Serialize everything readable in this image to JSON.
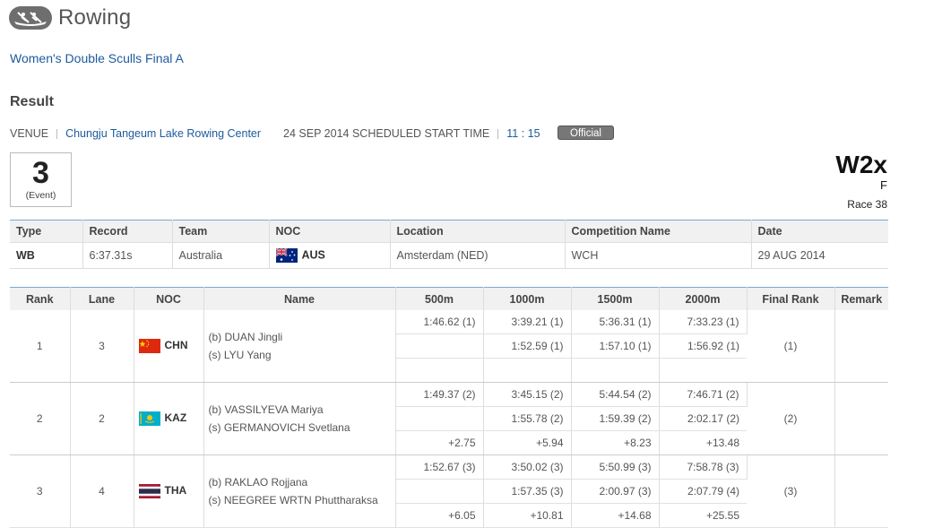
{
  "header": {
    "logo_icon": "rowing-icon",
    "sport": "Rowing"
  },
  "event_title": "Women's Double Sculls Final A",
  "result_heading": "Result",
  "venue": {
    "label": "VENUE",
    "name": "Chungju Tangeum Lake Rowing Center",
    "date_text": "24 SEP 2014 SCHEDULED START TIME",
    "time": "11 : 15",
    "status": "Official"
  },
  "event_box": {
    "number": "3",
    "label": "(Event)"
  },
  "event_code": {
    "code": "W2x",
    "gender": "F",
    "race": "Race 38"
  },
  "records": {
    "headers": [
      "Type",
      "Record",
      "Team",
      "NOC",
      "Location",
      "Competition Name",
      "Date"
    ],
    "rows": [
      {
        "type": "WB",
        "record": "6:37.31s",
        "team": "Australia",
        "noc": "AUS",
        "location": "Amsterdam (NED)",
        "competition": "WCH",
        "date": "29 AUG 2014"
      }
    ]
  },
  "results": {
    "headers": [
      "Rank",
      "Lane",
      "NOC",
      "Name",
      "500m",
      "1000m",
      "1500m",
      "2000m",
      "Final Rank",
      "Remark"
    ],
    "rows": [
      {
        "rank": "1",
        "lane": "3",
        "noc": "CHN",
        "name1": "(b) DUAN Jingli",
        "name2": "(s) LYU Yang",
        "s500": "1:46.62 (1)",
        "s1000": "3:39.21 (1)",
        "s1500": "5:36.31 (1)",
        "s2000": "7:33.23 (1)",
        "p1000": "1:52.59 (1)",
        "p1500": "1:57.10 (1)",
        "p2000": "1:56.92 (1)",
        "d500": "",
        "d1000": "",
        "d1500": "",
        "d2000": "",
        "final": "(1)",
        "remark": ""
      },
      {
        "rank": "2",
        "lane": "2",
        "noc": "KAZ",
        "name1": "(b) VASSILYEVA Mariya",
        "name2": "(s) GERMANOVICH Svetlana",
        "s500": "1:49.37 (2)",
        "s1000": "3:45.15 (2)",
        "s1500": "5:44.54 (2)",
        "s2000": "7:46.71 (2)",
        "p1000": "1:55.78 (2)",
        "p1500": "1:59.39 (2)",
        "p2000": "2:02.17 (2)",
        "d500": "+2.75",
        "d1000": "+5.94",
        "d1500": "+8.23",
        "d2000": "+13.48",
        "final": "(2)",
        "remark": ""
      },
      {
        "rank": "3",
        "lane": "4",
        "noc": "THA",
        "name1": "(b) RAKLAO Rojjana",
        "name2": "(s) NEEGREE WRTN Phuttharaksa",
        "s500": "1:52.67 (3)",
        "s1000": "3:50.02 (3)",
        "s1500": "5:50.99 (3)",
        "s2000": "7:58.78 (3)",
        "p1000": "1:57.35 (3)",
        "p1500": "2:00.97 (3)",
        "p2000": "2:07.79 (4)",
        "d500": "+6.05",
        "d1000": "+10.81",
        "d1500": "+14.68",
        "d2000": "+25.55",
        "final": "(3)",
        "remark": ""
      }
    ]
  }
}
